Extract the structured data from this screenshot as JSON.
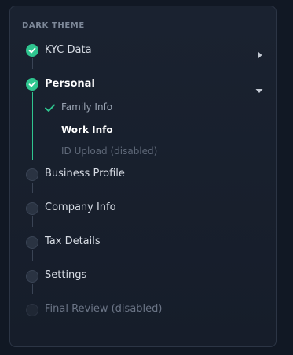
{
  "section_label": "DARK THEME",
  "steps": [
    {
      "label": "KYC Data",
      "status": "done",
      "chevron": "chevron-right-icon"
    },
    {
      "label": "Personal",
      "status": "done",
      "chevron": "chevron-down-icon",
      "substeps": [
        {
          "label": "Family Info",
          "status": "done"
        },
        {
          "label": "Work Info",
          "status": "current"
        },
        {
          "label": "ID Upload (disabled)",
          "status": "disabled"
        }
      ]
    },
    {
      "label": "Business Profile",
      "status": "pending"
    },
    {
      "label": "Company Info",
      "status": "pending"
    },
    {
      "label": "Tax Details",
      "status": "pending"
    },
    {
      "label": "Settings",
      "status": "pending"
    },
    {
      "label": "Final Review (disabled)",
      "status": "disabled"
    }
  ],
  "colors": {
    "accent": "#2fc58f",
    "background": "#111824",
    "panel": "#1a2230",
    "text": "#d7dce4",
    "muted": "#6b7586"
  }
}
